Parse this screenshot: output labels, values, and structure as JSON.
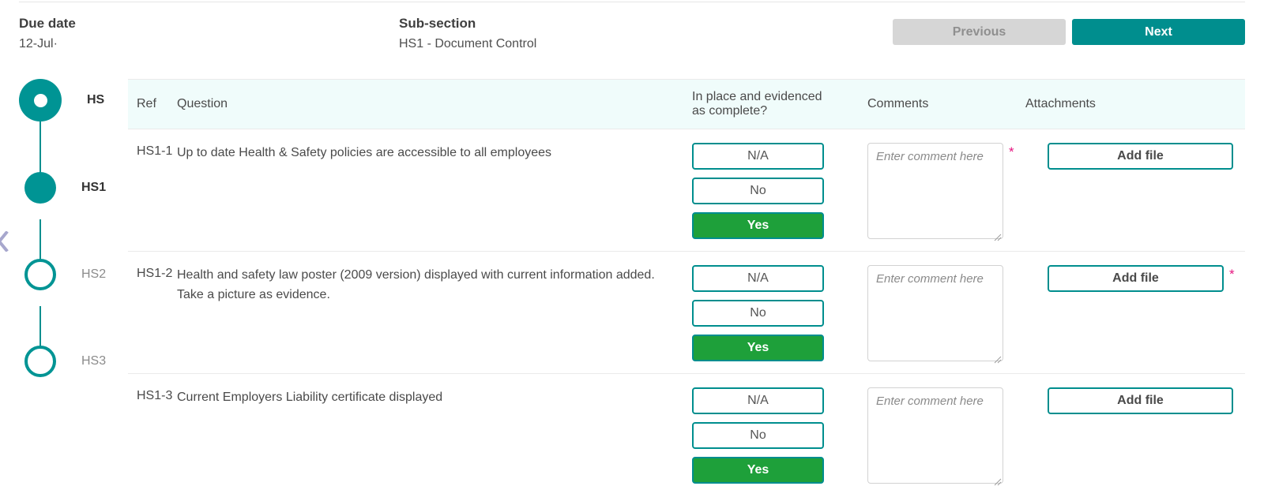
{
  "header": {
    "due_date_label": "Due date",
    "due_date_value": "12-Jul·",
    "sub_section_label": "Sub-section",
    "sub_section_value": "HS1 - Document Control",
    "previous_label": "Previous",
    "next_label": "Next"
  },
  "colors": {
    "teal": "#008e8e",
    "green": "#1ea03a",
    "header_bg": "#f0fcfb",
    "required_star": "#e5157f",
    "disabled_button": "#d6d6d6",
    "chevron": "#a7a7cd"
  },
  "stepper": {
    "items": [
      {
        "label": "HS",
        "state": "major",
        "active": true
      },
      {
        "label": "HS1",
        "state": "filled",
        "active": true
      },
      {
        "label": "HS2",
        "state": "hollow",
        "active": false
      },
      {
        "label": "HS3",
        "state": "hollow",
        "active": false
      }
    ]
  },
  "table": {
    "columns": {
      "ref": "Ref",
      "question": "Question",
      "answer_line1": "In place and evidenced",
      "answer_line2": "as complete?",
      "comments": "Comments",
      "attachments": "Attachments"
    },
    "answer_options": [
      "N/A",
      "No",
      "Yes"
    ],
    "comment_placeholder": "Enter comment here",
    "add_file_label": "Add file",
    "required_marker": "*",
    "rows": [
      {
        "ref": "HS1-1",
        "question": "Up to date Health & Safety policies are accessible to all employees",
        "selected_answer": "Yes",
        "comment_value": "",
        "comment_required": true,
        "attachment_required": false
      },
      {
        "ref": "HS1-2",
        "question": "Health and safety law poster (2009 version) displayed with current information added. Take a picture as evidence.",
        "selected_answer": "Yes",
        "comment_value": "",
        "comment_required": false,
        "attachment_required": true
      },
      {
        "ref": "HS1-3",
        "question": "Current Employers Liability certificate displayed",
        "selected_answer": "Yes",
        "comment_value": "",
        "comment_required": false,
        "attachment_required": false
      }
    ]
  }
}
